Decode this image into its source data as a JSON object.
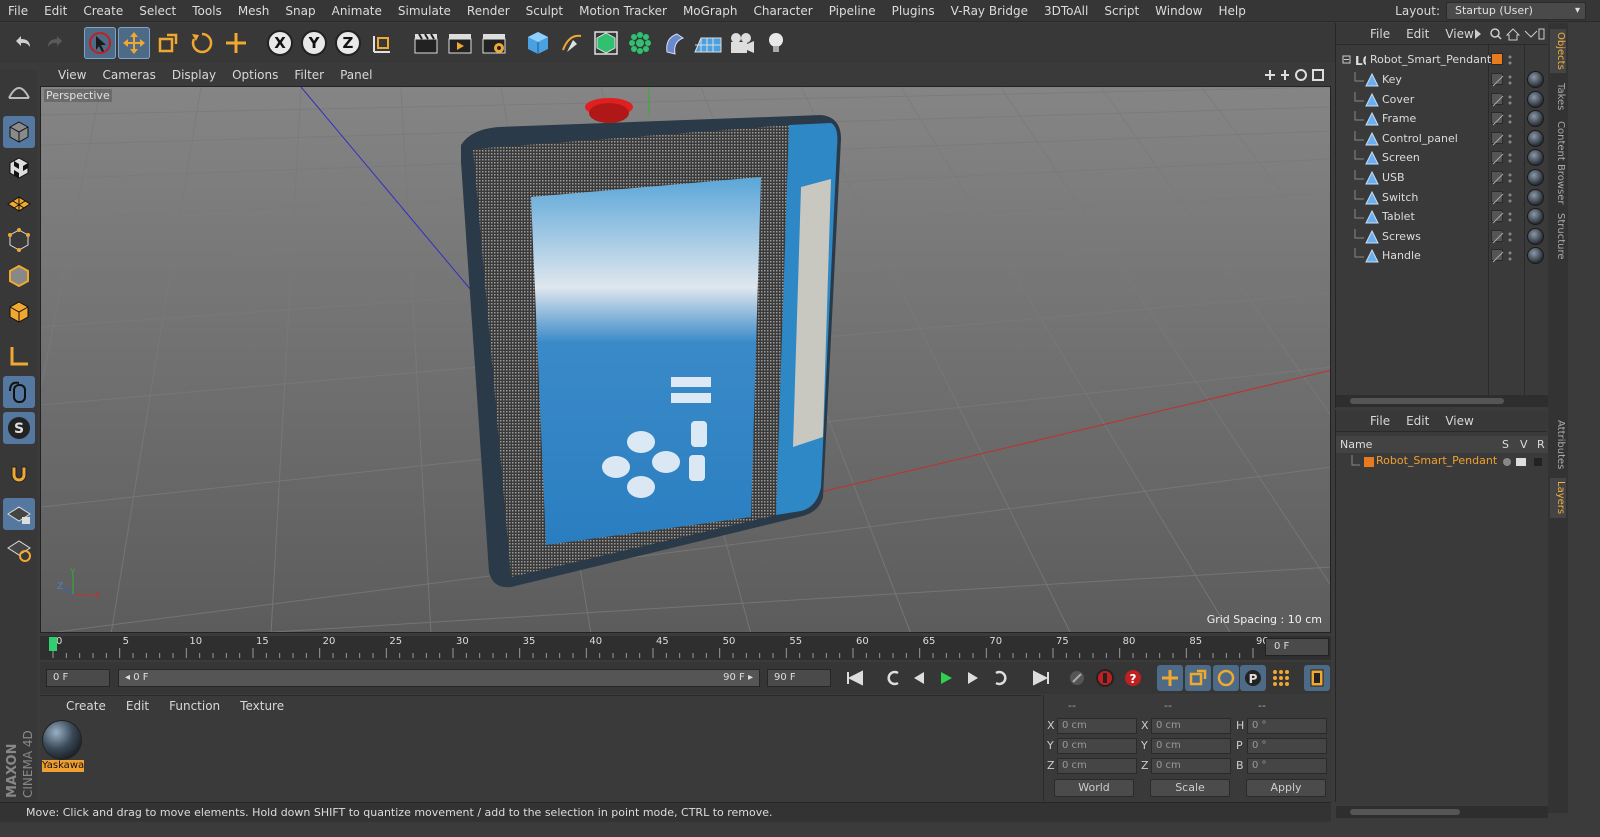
{
  "menubar": [
    "File",
    "Edit",
    "Create",
    "Select",
    "Tools",
    "Mesh",
    "Snap",
    "Animate",
    "Simulate",
    "Render",
    "Sculpt",
    "Motion Tracker",
    "MoGraph",
    "Character",
    "Pipeline",
    "Plugins",
    "V-Ray Bridge",
    "3DToAll",
    "Script",
    "Window",
    "Help"
  ],
  "layout": {
    "label": "Layout:",
    "value": "Startup (User)"
  },
  "viewport": {
    "menu": [
      "View",
      "Cameras",
      "Display",
      "Options",
      "Filter",
      "Panel"
    ],
    "label": "Perspective",
    "grid_spacing": "Grid Spacing : 10 cm"
  },
  "timeline": {
    "ticks": [
      "0",
      "5",
      "10",
      "15",
      "20",
      "25",
      "30",
      "35",
      "40",
      "45",
      "50",
      "55",
      "60",
      "65",
      "70",
      "75",
      "80",
      "85",
      "90"
    ],
    "current": "0 F"
  },
  "playbar": {
    "start": "0 F",
    "range_start": "◂ 0 F",
    "range_end": "90 F ▸",
    "end": "90 F"
  },
  "materials": {
    "menu": [
      "Create",
      "Edit",
      "Function",
      "Texture"
    ],
    "items": [
      {
        "name": "Yaskawa"
      }
    ]
  },
  "coordinates": {
    "header": [
      "--",
      "--",
      "--"
    ],
    "rows": [
      {
        "a": "X",
        "av": "0 cm",
        "b": "X",
        "bv": "0 cm",
        "c": "H",
        "cv": "0 °"
      },
      {
        "a": "Y",
        "av": "0 cm",
        "b": "Y",
        "bv": "0 cm",
        "c": "P",
        "cv": "0 °"
      },
      {
        "a": "Z",
        "av": "0 cm",
        "b": "Z",
        "bv": "0 cm",
        "c": "B",
        "cv": "0 °"
      }
    ],
    "world": "World",
    "scale": "Scale",
    "apply": "Apply"
  },
  "status": "Move: Click and drag to move elements. Hold down SHIFT to quantize movement / add to the selection in point mode, CTRL to remove.",
  "brand": {
    "a": "MAXON",
    "b": "CINEMA 4D"
  },
  "objects": {
    "menu": [
      "File",
      "Edit",
      "View"
    ],
    "root": "Robot_Smart_Pendant",
    "children": [
      "Key",
      "Cover",
      "Frame",
      "Control_panel",
      "Screen",
      "USB",
      "Switch",
      "Tablet",
      "Screws",
      "Handle"
    ]
  },
  "layers": {
    "menu": [
      "File",
      "Edit",
      "View"
    ],
    "columns": {
      "name": "Name",
      "s": "S",
      "v": "V",
      "r": "R"
    },
    "items": [
      "Robot_Smart_Pendant"
    ]
  },
  "sidetabs": [
    "Objects",
    "Takes",
    "Content Browser",
    "Structure",
    "Attributes",
    "Layers"
  ],
  "colors": {
    "accent": "#f0a030",
    "selection": "#5478a0",
    "layer": "#e87a20"
  }
}
